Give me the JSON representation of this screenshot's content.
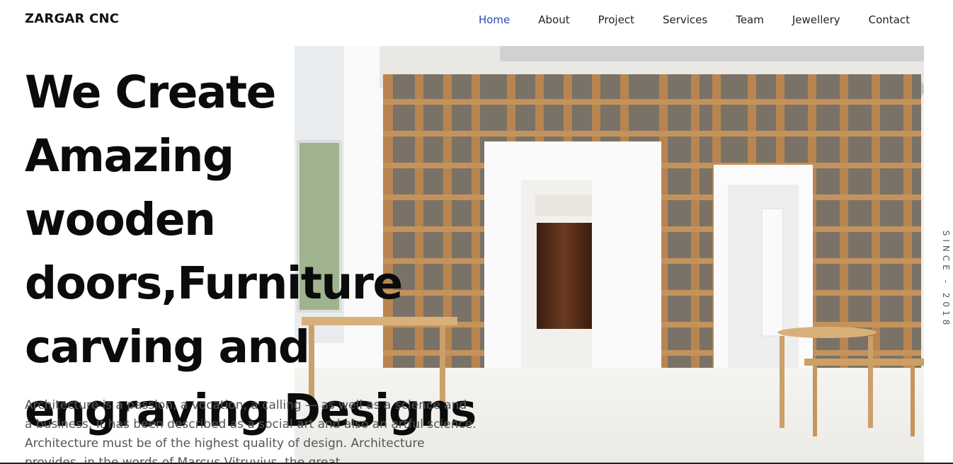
{
  "brand": {
    "name": "ZARGAR CNC"
  },
  "nav": {
    "items": [
      {
        "label": "Home",
        "active": true
      },
      {
        "label": "About",
        "active": false
      },
      {
        "label": "Project",
        "active": false
      },
      {
        "label": "Services",
        "active": false
      },
      {
        "label": "Team",
        "active": false
      },
      {
        "label": "Jewellery",
        "active": false
      },
      {
        "label": "Contact",
        "active": false
      }
    ]
  },
  "hero": {
    "headline_lines": [
      "We Create Amazing",
      "wooden",
      "doors,Furniture",
      "carving and",
      "engraving Designs"
    ],
    "description": "Architecture is a passion, a vocation, a calling — as well as a science and a business. It has been described as a social art and also an artful science. Architecture must be of the highest quality of design. Architecture provides, in the words of Marcus Vitruvius, the great",
    "side_text": "SINCE - 2018"
  },
  "colors": {
    "accent": "#2b48b5",
    "text_dark": "#0b0b0b",
    "text_muted": "#555555"
  }
}
